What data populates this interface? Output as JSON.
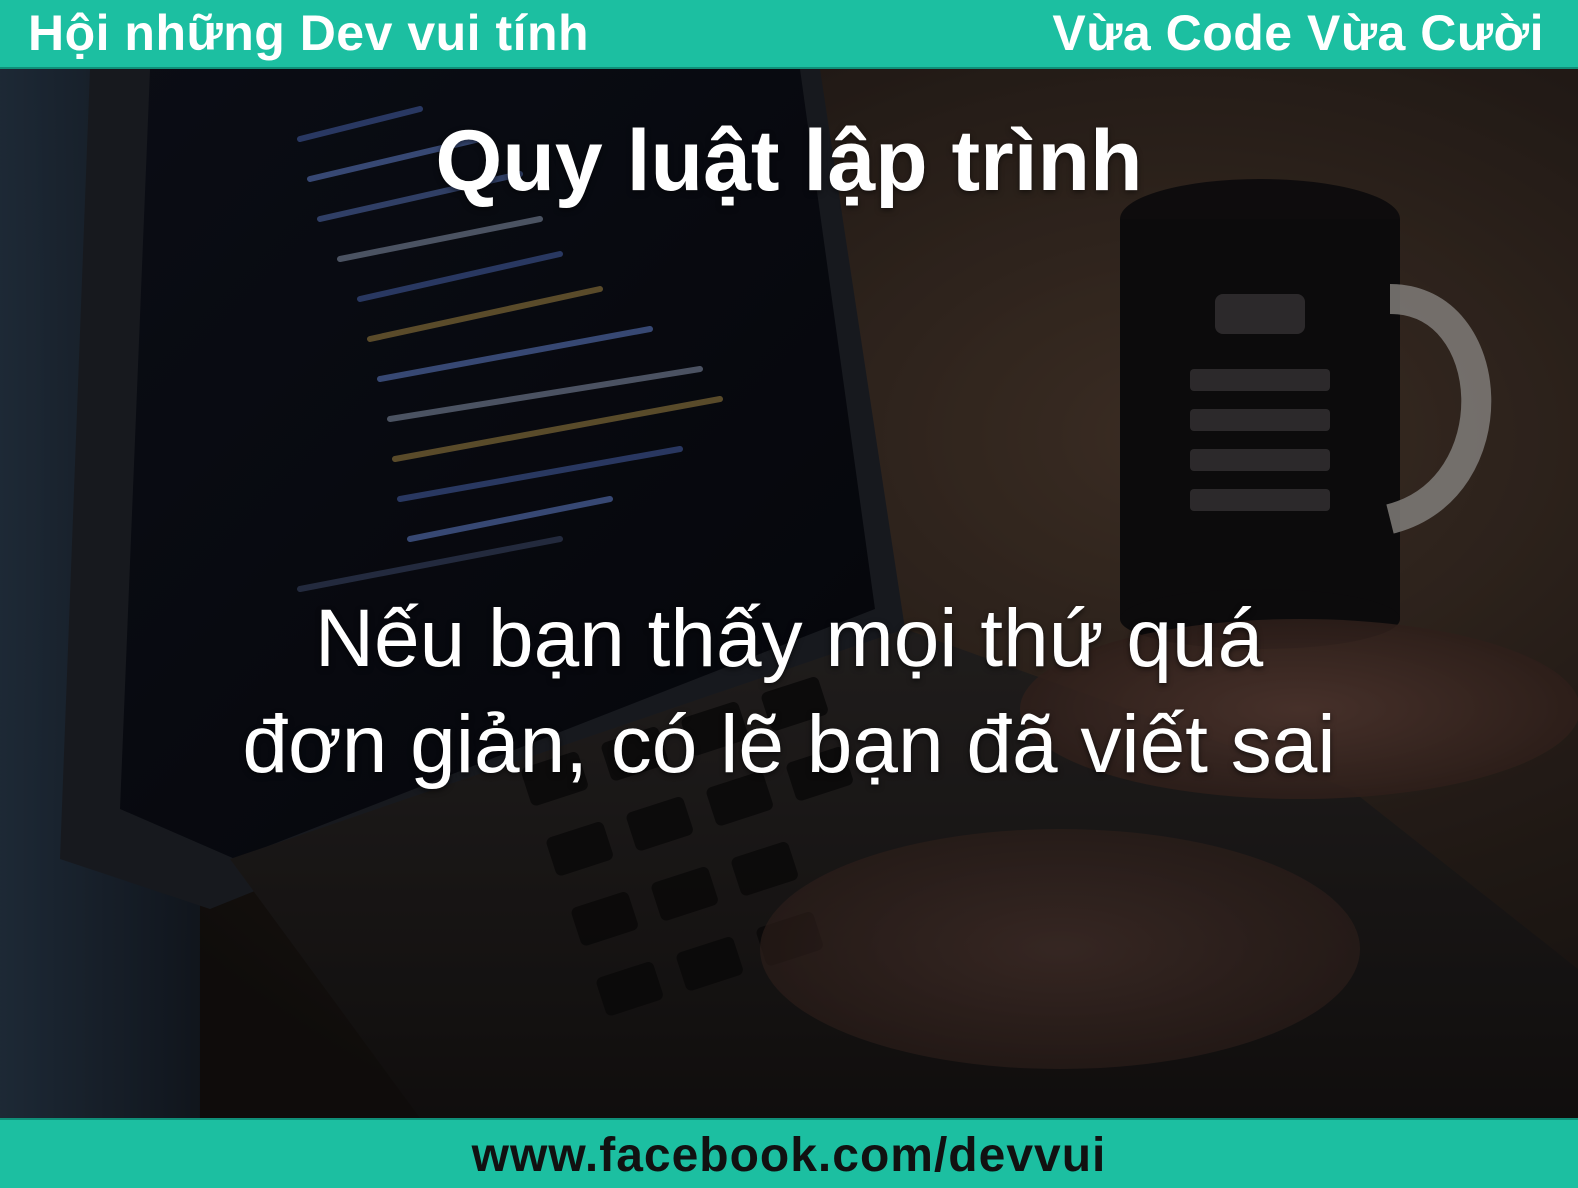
{
  "header": {
    "left_text": "Hội những Dev vui tính",
    "right_text": "Vừa Code Vừa Cười"
  },
  "main": {
    "title": "Quy luật lập trình",
    "quote_line_1": "Nếu bạn thấy mọi thứ quá",
    "quote_line_2": "đơn giản, có lẽ bạn đã viết sai"
  },
  "footer": {
    "url": "www.facebook.com/devvui"
  },
  "colors": {
    "brand_bar": "#1cbfa1",
    "header_text": "#ffffff",
    "footer_text": "#111111"
  },
  "background_image": {
    "subject": "laptop-with-code-and-coffee-mug"
  }
}
